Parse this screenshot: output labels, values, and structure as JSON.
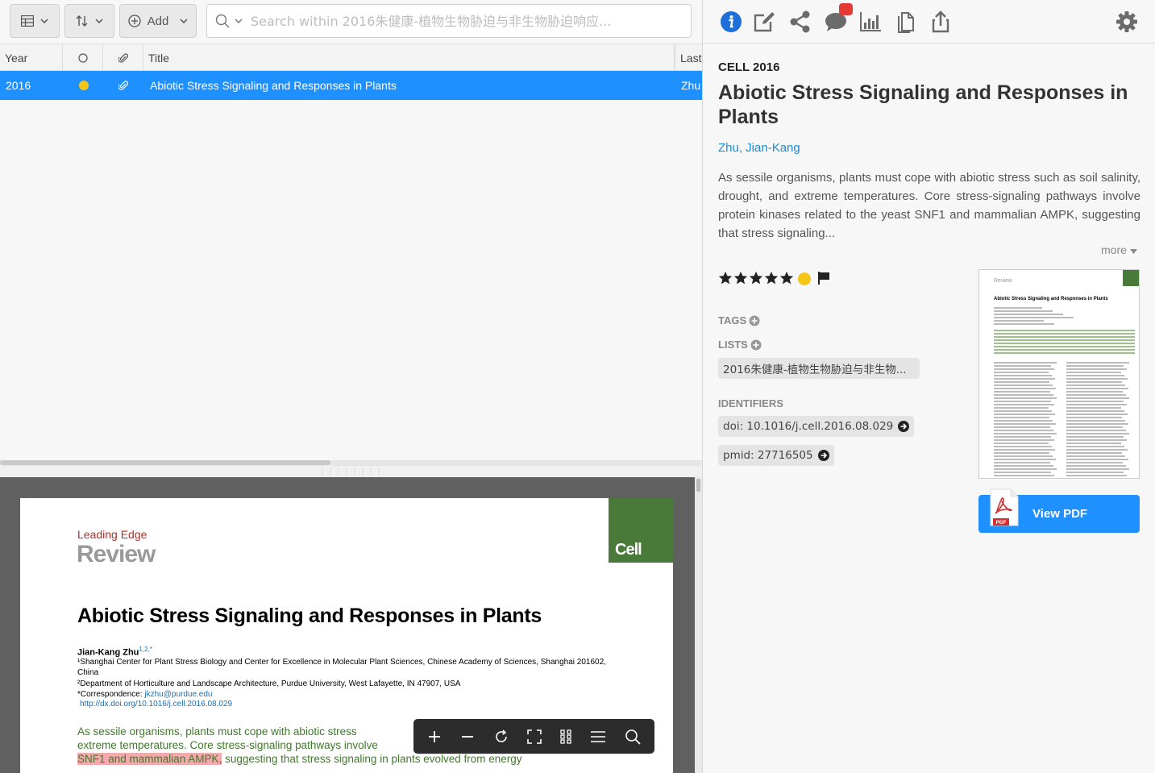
{
  "toolbar": {
    "add_label": "Add",
    "search_placeholder": "Search within 2016朱健康-植物生物胁迫与非生物胁迫响应..."
  },
  "list": {
    "columns": [
      "Year",
      "Title",
      "Last"
    ],
    "rows": [
      {
        "year": "2016",
        "title": "Abiotic Stress Signaling and Responses in Plants",
        "author": "Zhu"
      }
    ]
  },
  "pdf": {
    "kicker": "Leading Edge",
    "section": "Review",
    "journal_logo": "Cell",
    "title": "Abiotic Stress Signaling and Responses in Plants",
    "author": "Jian-Kang Zhu",
    "author_sup": "1,2,*",
    "aff1": "¹Shanghai Center for Plant Stress Biology and Center for Excellence in Molecular Plant Sciences, Chinese Academy of Sciences, Shanghai 201602, China",
    "aff2": "²Department of Horticulture and Landscape Architecture, Purdue University, West Lafayette, IN 47907, USA",
    "corr_label": "*Correspondence: ",
    "corr_email": "jkzhu@purdue.edu",
    "doi_url": "http://dx.doi.org/10.1016/j.cell.2016.08.029",
    "abstract_a": "As sessile organisms, plants must cope with abiotic stress",
    "abstract_b": "extreme temperatures. Core stress-signaling pathways involve",
    "abstract_hl": "SNF1 and mammalian AMPK,",
    "abstract_c": " suggesting that stress signaling in plants evolved from energy"
  },
  "detail": {
    "journal_year": "CELL 2016",
    "title": "Abiotic Stress Signaling and Responses in Plants",
    "author": "Zhu, Jian-Kang",
    "abstract": "As sessile organisms, plants must cope with abiotic stress such as soil salinity, drought, and extreme temperatures. Core stress-signaling pathways involve protein kinases related to the yeast SNF1 and mammalian AMPK, suggesting that stress signaling...",
    "more": "more",
    "rating": 5,
    "tags_label": "TAGS",
    "lists_label": "LISTS",
    "list_item": "2016朱健康-植物生物胁迫与非生物...",
    "identifiers_label": "IDENTIFIERS",
    "doi": "doi: 10.1016/j.cell.2016.08.029",
    "pmid": "pmid: 27716505",
    "view_pdf": "View PDF",
    "pdf_icon_label": "PDF"
  },
  "colors": {
    "accent": "#1e90ff",
    "read_dot": "#f5c518",
    "cell_green": "#4a7a3a",
    "badge": "#e53935"
  },
  "icons": [
    "table-view-icon",
    "sort-icon",
    "add-icon",
    "search-icon",
    "info-icon",
    "edit-icon",
    "share-icon",
    "comments-icon",
    "stats-icon",
    "files-icon",
    "export-icon",
    "gear-icon",
    "zoom-in-icon",
    "zoom-out-icon",
    "rotate-icon",
    "fullscreen-icon",
    "grid-icon",
    "menu-icon",
    "search-icon"
  ]
}
